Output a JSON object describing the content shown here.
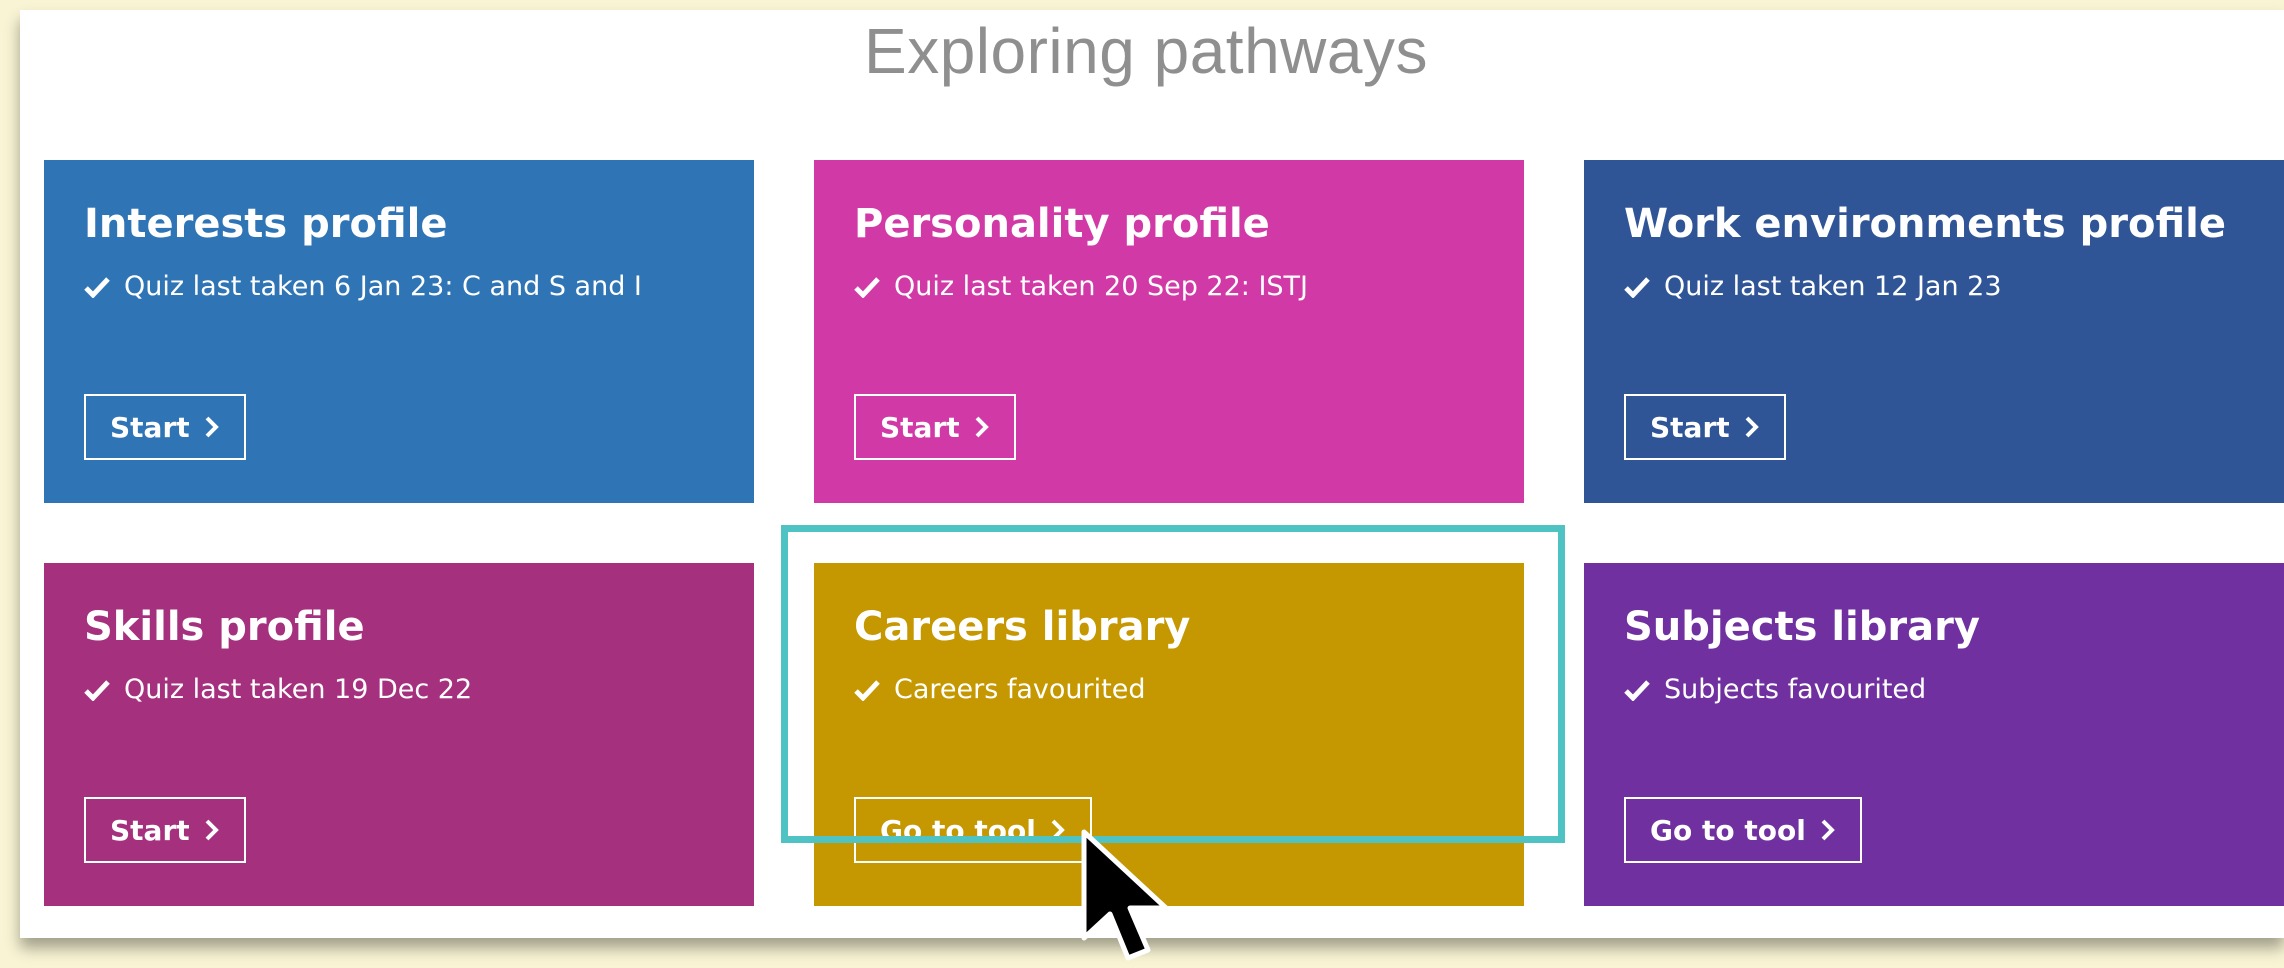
{
  "page": {
    "title": "Exploring pathways"
  },
  "colors": {
    "background": "#f8f4d4",
    "panel": "#ffffff",
    "highlight": "#4fc3c3",
    "interests": "#2f74b5",
    "personality": "#d13aa6",
    "work_environments": "#2f5597",
    "skills": "#a5307e",
    "careers": "#c59700",
    "subjects": "#7030a0"
  },
  "cards": [
    {
      "id": "interests",
      "title": "Interests profile",
      "status": "Quiz last taken 6 Jan 23: C and S and I",
      "button": "Start",
      "icon": "check-icon"
    },
    {
      "id": "personality",
      "title": "Personality profile",
      "status": "Quiz last taken 20 Sep 22: ISTJ",
      "button": "Start",
      "icon": "check-icon"
    },
    {
      "id": "work-environments",
      "title": "Work environments profile",
      "status": "Quiz last taken 12 Jan 23",
      "button": "Start",
      "icon": "check-icon"
    },
    {
      "id": "skills",
      "title": "Skills profile",
      "status": "Quiz last taken 19 Dec 22",
      "button": "Start",
      "icon": "check-icon"
    },
    {
      "id": "careers",
      "title": "Careers library",
      "status": "Careers favourited",
      "button": "Go to tool",
      "icon": "check-icon"
    },
    {
      "id": "subjects",
      "title": "Subjects library",
      "status": "Subjects favourited",
      "button": "Go to tool",
      "icon": "check-icon"
    }
  ],
  "icons": {
    "status": "check-icon",
    "button": "chevron-right-icon",
    "pointer": "mouse-cursor-icon"
  }
}
